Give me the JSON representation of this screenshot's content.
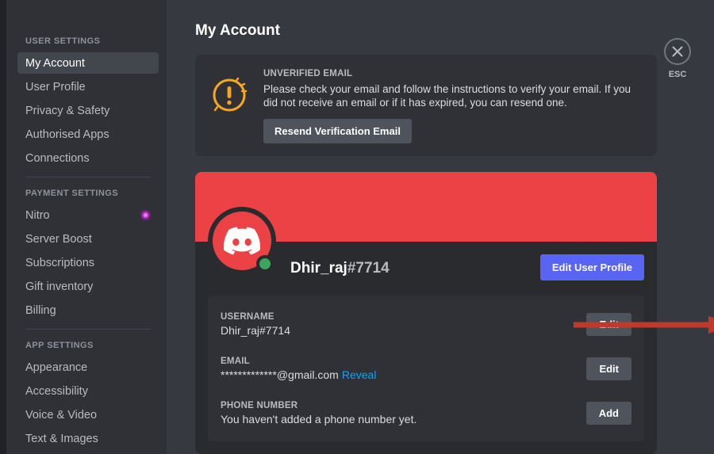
{
  "sidebar": {
    "sections": [
      {
        "header": "USER SETTINGS",
        "items": [
          {
            "label": "My Account",
            "active": true
          },
          {
            "label": "User Profile",
            "active": false
          },
          {
            "label": "Privacy & Safety",
            "active": false
          },
          {
            "label": "Authorised Apps",
            "active": false
          },
          {
            "label": "Connections",
            "active": false
          }
        ]
      },
      {
        "header": "PAYMENT SETTINGS",
        "items": [
          {
            "label": "Nitro",
            "active": false,
            "badge": "nitro-badge-icon"
          },
          {
            "label": "Server Boost",
            "active": false
          },
          {
            "label": "Subscriptions",
            "active": false
          },
          {
            "label": "Gift inventory",
            "active": false
          },
          {
            "label": "Billing",
            "active": false
          }
        ]
      },
      {
        "header": "APP SETTINGS",
        "items": [
          {
            "label": "Appearance",
            "active": false
          },
          {
            "label": "Accessibility",
            "active": false
          },
          {
            "label": "Voice & Video",
            "active": false
          },
          {
            "label": "Text & Images",
            "active": false
          }
        ]
      }
    ]
  },
  "page": {
    "title": "My Account"
  },
  "warning": {
    "icon": "warning-exclamation-icon",
    "label": "UNVERIFIED EMAIL",
    "text": "Please check your email and follow the instructions to verify your email. If you did not receive an email or if it has expired, you can resend one.",
    "button": "Resend Verification Email"
  },
  "profile": {
    "banner_color": "#ed4245",
    "avatar_icon": "discord-logo-icon",
    "status": "online",
    "username": "Dhir_raj",
    "discriminator": "#7714",
    "edit_profile_button": "Edit User Profile"
  },
  "fields": [
    {
      "label": "USERNAME",
      "value": "Dhir_raj#7714",
      "reveal": "",
      "button": "Edit"
    },
    {
      "label": "EMAIL",
      "value": "*************@gmail.com",
      "reveal": "Reveal",
      "button": "Edit"
    },
    {
      "label": "PHONE NUMBER",
      "value": "You haven't added a phone number yet.",
      "reveal": "",
      "button": "Add"
    }
  ],
  "close": {
    "icon": "close-x-icon",
    "label": "ESC"
  },
  "annotation": {
    "type": "arrow",
    "color": "#c0392b",
    "points_to": "username-edit-button"
  },
  "colors": {
    "accent_blurple": "#5865F2",
    "banner_red": "#ed4245",
    "link_blue": "#00a8fc",
    "online_green": "#3ba55d",
    "warning_orange": "#faa61a",
    "nitro_purple": "#b930c9"
  }
}
